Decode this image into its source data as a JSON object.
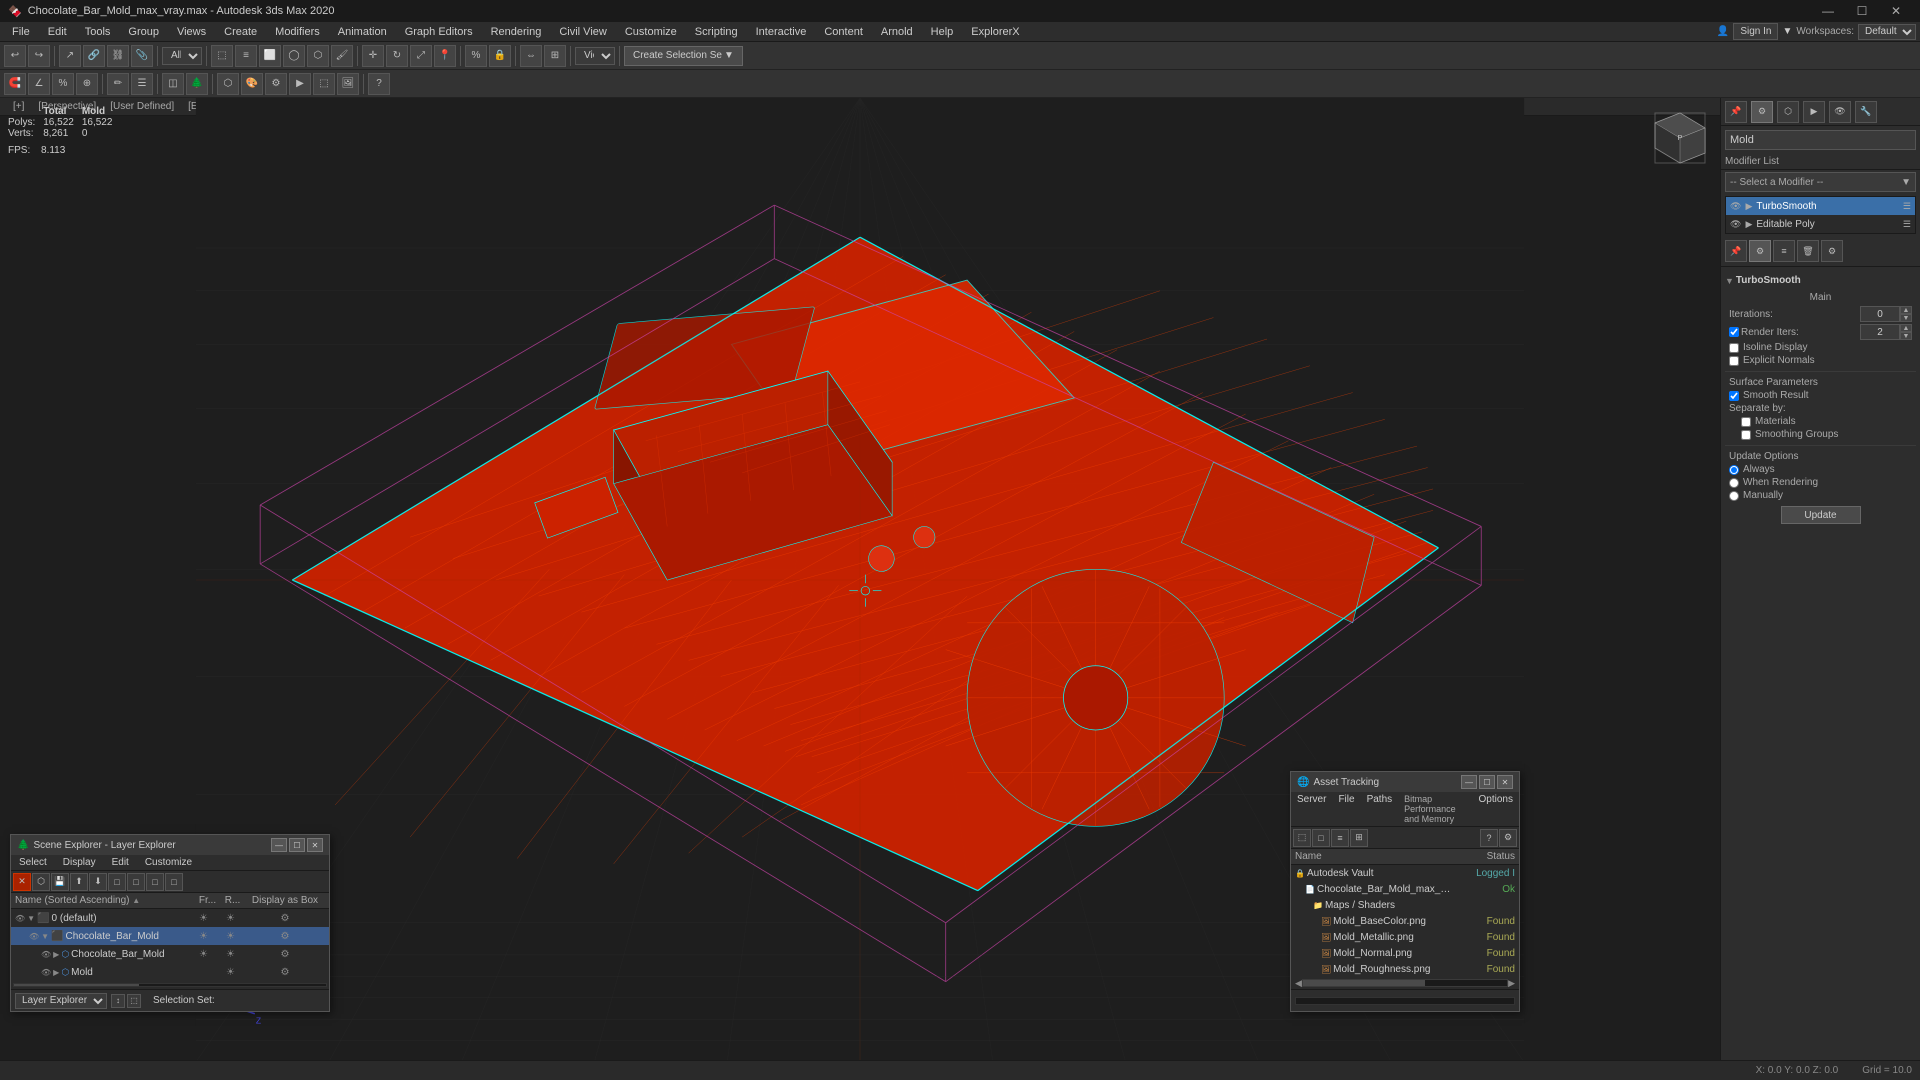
{
  "titlebar": {
    "title": "Chocolate_Bar_Mold_max_vray.max - Autodesk 3ds Max 2020",
    "icon": "🍫",
    "controls": [
      "—",
      "☐",
      "✕"
    ]
  },
  "menubar": {
    "items": [
      "File",
      "Edit",
      "Tools",
      "Group",
      "Views",
      "Create",
      "Modifiers",
      "Animation",
      "Graph Editors",
      "Rendering",
      "Civil View",
      "Customize",
      "Scripting",
      "Interactive",
      "Content",
      "Arnold",
      "Help",
      "ExplorerX"
    ]
  },
  "toolbar": {
    "create_selection_label": "Create Selection Se",
    "view_label": "View",
    "all_label": "All"
  },
  "viewport": {
    "labels": [
      "[+]",
      "[Perspective]",
      "[User Defined]",
      "[Edged Faces]"
    ],
    "stats": {
      "headers": [
        "",
        "Total",
        "Mold"
      ],
      "polys_label": "Polys:",
      "polys_total": "16,522",
      "polys_mold": "16,522",
      "verts_label": "Verts:",
      "verts_total": "8,261",
      "verts_mold": "0",
      "fps_label": "FPS:",
      "fps_value": "8.113"
    }
  },
  "right_panel": {
    "object_name": "Mold",
    "modifier_list_label": "Modifier List",
    "modifiers": [
      {
        "name": "TurboSmooth",
        "active": true,
        "visible": true
      },
      {
        "name": "Editable Poly",
        "active": false,
        "visible": true
      }
    ],
    "turbosmooth": {
      "title": "TurboSmooth",
      "main_label": "Main",
      "iterations_label": "Iterations:",
      "iterations_value": "0",
      "render_iters_label": "Render Iters:",
      "render_iters_value": "2",
      "render_iters_checked": true,
      "isoline_display": "Isoline Display",
      "isoline_checked": false,
      "explicit_normals": "Explicit Normals",
      "explicit_checked": false,
      "surface_params": "Surface Parameters",
      "smooth_result": "Smooth Result",
      "smooth_checked": true,
      "separate_by": "Separate by:",
      "materials": "Materials",
      "materials_checked": false,
      "smoothing_groups": "Smoothing Groups",
      "smoothing_checked": false,
      "update_options": "Update Options",
      "always": "Always",
      "always_checked": true,
      "when_rendering": "When Rendering",
      "when_rendering_checked": false,
      "manually": "Manually",
      "manually_checked": false,
      "update_btn": "Update"
    }
  },
  "layer_explorer": {
    "title": "Scene Explorer - Layer Explorer",
    "menus": [
      "Select",
      "Display",
      "Edit",
      "Customize"
    ],
    "toolbar_buttons": [
      "✕",
      "📋",
      "💾",
      "⬆",
      "⬇",
      "□",
      "□",
      "□",
      "□"
    ],
    "columns": {
      "name": "Name (Sorted Ascending)",
      "fr": "Fr...",
      "r": "R...",
      "display": "Display as Box"
    },
    "layers": [
      {
        "indent": 0,
        "name": "0 (default)",
        "type": "layer",
        "fr": "☀",
        "r": "☀",
        "display": "⚙"
      },
      {
        "indent": 1,
        "name": "Chocolate_Bar_Mold",
        "type": "object",
        "fr": "☀",
        "r": "☀",
        "display": "⚙",
        "selected": true
      },
      {
        "indent": 2,
        "name": "Chocolate_Bar_Mold",
        "type": "mesh",
        "fr": "☀",
        "r": "☀",
        "display": "⚙"
      },
      {
        "indent": 2,
        "name": "Mold",
        "type": "mesh",
        "fr": "",
        "r": "☀",
        "display": "⚙"
      }
    ],
    "footer": {
      "label": "Layer Explorer",
      "selection_set": "Selection Set:"
    }
  },
  "asset_tracking": {
    "title": "Asset Tracking",
    "menus": [
      "Server",
      "File",
      "Paths"
    ],
    "bitmap_label": "Bitmap Performance and Memory",
    "options_label": "Options",
    "columns": {
      "name": "Name",
      "status": "Status"
    },
    "assets": [
      {
        "indent": 0,
        "name": "Autodesk Vault",
        "status": "Logged I",
        "type": "vault"
      },
      {
        "indent": 1,
        "name": "Chocolate_Bar_Mold_max_vray.max",
        "status": "Ok",
        "type": "file"
      },
      {
        "indent": 2,
        "name": "Maps / Shaders",
        "status": "",
        "type": "folder"
      },
      {
        "indent": 3,
        "name": "Mold_BaseColor.png",
        "status": "Found",
        "type": "image"
      },
      {
        "indent": 3,
        "name": "Mold_Metallic.png",
        "status": "Found",
        "type": "image"
      },
      {
        "indent": 3,
        "name": "Mold_Normal.png",
        "status": "Found",
        "type": "image"
      },
      {
        "indent": 3,
        "name": "Mold_Roughness.png",
        "status": "Found",
        "type": "image"
      }
    ]
  },
  "status_bar": {
    "text": ""
  },
  "signin": {
    "label": "Sign In",
    "workspaces_label": "Workspaces:",
    "workspace_value": "Default"
  }
}
